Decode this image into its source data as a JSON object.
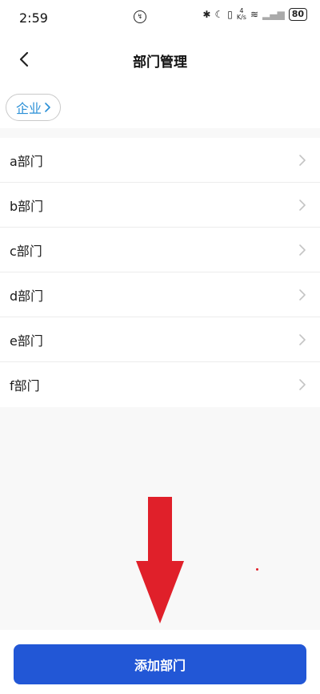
{
  "status_bar": {
    "time": "2:59",
    "net_speed_value": "4",
    "net_speed_unit": "K/s",
    "battery": "80"
  },
  "nav": {
    "title": "部门管理"
  },
  "breadcrumb": {
    "label": "企业"
  },
  "departments": [
    {
      "name": "a部门"
    },
    {
      "name": "b部门"
    },
    {
      "name": "c部门"
    },
    {
      "name": "d部门"
    },
    {
      "name": "e部门"
    },
    {
      "name": "f部门"
    }
  ],
  "actions": {
    "add_label": "添加部门"
  },
  "colors": {
    "primary": "#2257d6",
    "link": "#2a8fd6",
    "annotation_red": "#e0202a"
  }
}
